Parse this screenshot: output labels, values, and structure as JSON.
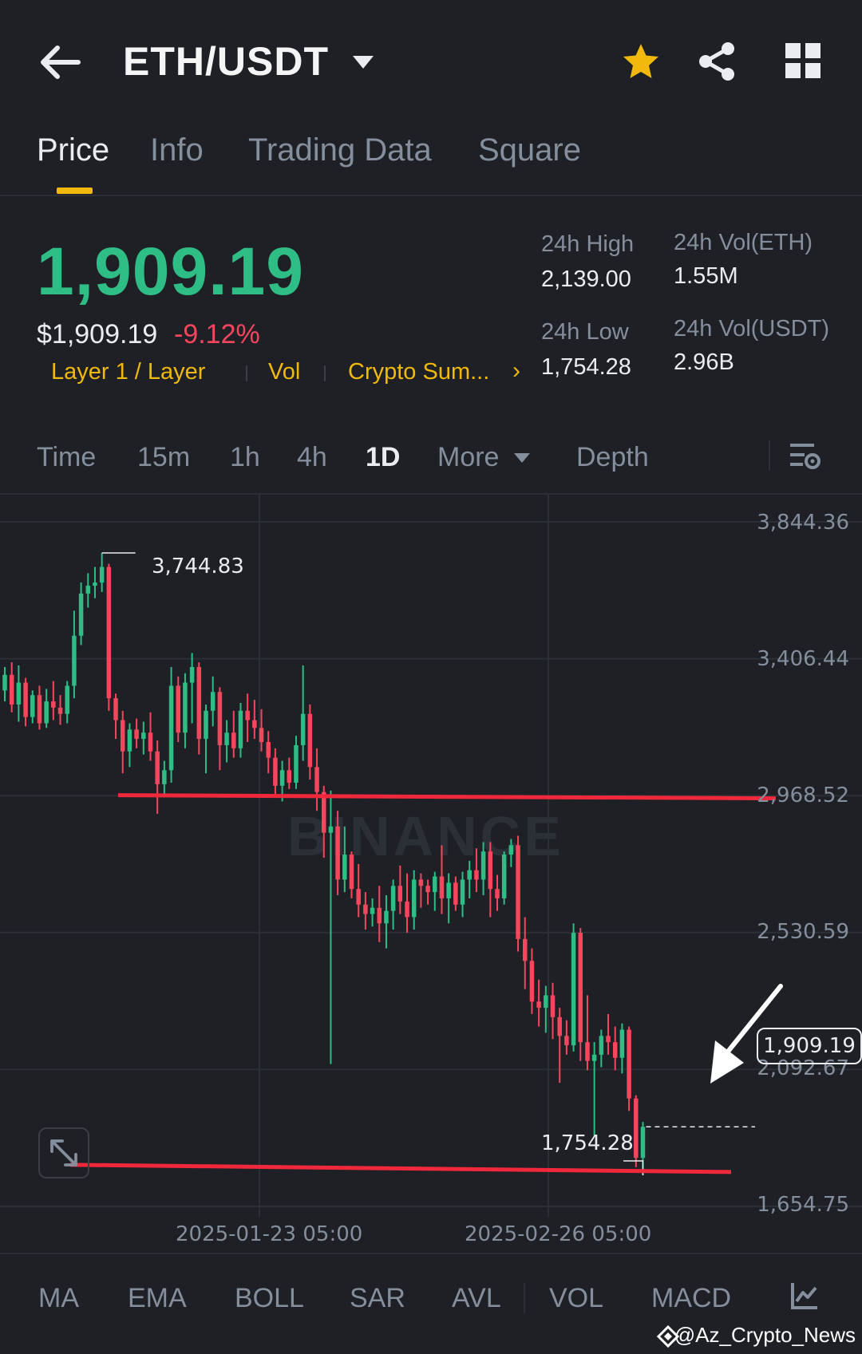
{
  "header": {
    "pair": "ETH/USDT"
  },
  "tabs": [
    {
      "label": "Price",
      "active": true
    },
    {
      "label": "Info",
      "active": false
    },
    {
      "label": "Trading Data",
      "active": false
    },
    {
      "label": "Square",
      "active": false
    }
  ],
  "price": {
    "last": "1,909.19",
    "usd": "$1,909.19",
    "change": "-9.12%",
    "tags": [
      "Layer 1 / Layer",
      "Vol",
      "Crypto Sum..."
    ],
    "tags_more": "›"
  },
  "stats": {
    "high_label": "24h High",
    "high_value": "2,139.00",
    "low_label": "24h Low",
    "low_value": "1,754.28",
    "vol_eth_label": "24h Vol(ETH)",
    "vol_eth_value": "1.55M",
    "vol_usdt_label": "24h Vol(USDT)",
    "vol_usdt_value": "2.96B"
  },
  "intervals": {
    "time": "Time",
    "m15": "15m",
    "h1": "1h",
    "h4": "4h",
    "d1": "1D",
    "more": "More",
    "depth": "Depth",
    "selected": "1D"
  },
  "chart": {
    "watermark": "BINANCE",
    "y_labels": [
      "3,844.36",
      "3,406.44",
      "2,968.52",
      "2,530.59",
      "2,092.67",
      "1,654.75"
    ],
    "x_labels": [
      "2025-01-23 05:00",
      "2025-02-26 05:00"
    ],
    "high_annotation": "3,744.83",
    "low_annotation": "1,754.28",
    "current_price_tag": "1,909.19"
  },
  "chart_data": {
    "type": "candlestick",
    "interval": "1D",
    "ylim": [
      1654.75,
      3844.36
    ],
    "y_ticks": [
      3844.36,
      3406.44,
      2968.52,
      2530.59,
      2092.67,
      1654.75
    ],
    "x_ticks": [
      "2025-01-23 05:00",
      "2025-02-26 05:00"
    ],
    "period_high": 3744.83,
    "period_low": 1754.28,
    "last_price": 1909.19,
    "drawn_lines": [
      {
        "type": "horizontal",
        "price": 2965,
        "color": "#f0283c"
      },
      {
        "type": "horizontal",
        "price": 1775,
        "color": "#f0283c"
      }
    ],
    "colors": {
      "up": "#2ebd85",
      "down": "#f6465d"
    },
    "candles": [
      [
        3305,
        3380,
        3270,
        3355
      ],
      [
        3355,
        3395,
        3235,
        3260
      ],
      [
        3260,
        3385,
        3205,
        3330
      ],
      [
        3330,
        3345,
        3190,
        3220
      ],
      [
        3220,
        3305,
        3200,
        3290
      ],
      [
        3290,
        3320,
        3180,
        3200
      ],
      [
        3200,
        3310,
        3185,
        3270
      ],
      [
        3270,
        3335,
        3210,
        3250
      ],
      [
        3250,
        3290,
        3195,
        3230
      ],
      [
        3230,
        3335,
        3200,
        3320
      ],
      [
        3320,
        3560,
        3280,
        3480
      ],
      [
        3480,
        3650,
        3450,
        3615
      ],
      [
        3615,
        3680,
        3570,
        3640
      ],
      [
        3640,
        3700,
        3600,
        3650
      ],
      [
        3650,
        3745,
        3620,
        3700
      ],
      [
        3700,
        3710,
        3240,
        3280
      ],
      [
        3280,
        3295,
        3150,
        3210
      ],
      [
        3210,
        3240,
        3040,
        3110
      ],
      [
        3110,
        3200,
        3060,
        3180
      ],
      [
        3180,
        3215,
        3120,
        3150
      ],
      [
        3150,
        3205,
        3100,
        3170
      ],
      [
        3170,
        3235,
        3080,
        3110
      ],
      [
        3110,
        3145,
        2910,
        3005
      ],
      [
        3005,
        3080,
        2970,
        3050
      ],
      [
        3050,
        3380,
        3010,
        3320
      ],
      [
        3320,
        3350,
        3140,
        3170
      ],
      [
        3170,
        3360,
        3120,
        3330
      ],
      [
        3330,
        3425,
        3200,
        3380
      ],
      [
        3380,
        3395,
        3100,
        3150
      ],
      [
        3150,
        3260,
        3040,
        3240
      ],
      [
        3240,
        3350,
        3190,
        3300
      ],
      [
        3300,
        3315,
        3050,
        3130
      ],
      [
        3130,
        3210,
        3075,
        3170
      ],
      [
        3170,
        3240,
        3090,
        3120
      ],
      [
        3120,
        3265,
        3090,
        3240
      ],
      [
        3240,
        3295,
        3140,
        3210
      ],
      [
        3210,
        3275,
        3150,
        3185
      ],
      [
        3185,
        3245,
        3110,
        3140
      ],
      [
        3140,
        3175,
        3040,
        3090
      ],
      [
        3090,
        3120,
        2965,
        3000
      ],
      [
        3000,
        3080,
        2950,
        3050
      ],
      [
        3050,
        3090,
        2990,
        3010
      ],
      [
        3010,
        3160,
        2990,
        3130
      ],
      [
        3130,
        3385,
        3080,
        3230
      ],
      [
        3230,
        3260,
        3020,
        3060
      ],
      [
        3060,
        3120,
        2920,
        2980
      ],
      [
        2980,
        3000,
        2770,
        2850
      ],
      [
        2850,
        2985,
        2110,
        2870
      ],
      [
        2870,
        2920,
        2650,
        2700
      ],
      [
        2700,
        2870,
        2660,
        2780
      ],
      [
        2780,
        2790,
        2640,
        2670
      ],
      [
        2670,
        2750,
        2580,
        2620
      ],
      [
        2620,
        2660,
        2540,
        2590
      ],
      [
        2590,
        2640,
        2550,
        2610
      ],
      [
        2610,
        2680,
        2500,
        2560
      ],
      [
        2560,
        2650,
        2480,
        2600
      ],
      [
        2600,
        2700,
        2540,
        2680
      ],
      [
        2680,
        2745,
        2590,
        2630
      ],
      [
        2630,
        2720,
        2530,
        2580
      ],
      [
        2580,
        2730,
        2540,
        2700
      ],
      [
        2700,
        2720,
        2610,
        2680
      ],
      [
        2680,
        2700,
        2620,
        2660
      ],
      [
        2660,
        2725,
        2600,
        2710
      ],
      [
        2710,
        2810,
        2590,
        2640
      ],
      [
        2640,
        2720,
        2560,
        2690
      ],
      [
        2690,
        2710,
        2600,
        2620
      ],
      [
        2620,
        2725,
        2580,
        2700
      ],
      [
        2700,
        2760,
        2640,
        2730
      ],
      [
        2730,
        2800,
        2660,
        2700
      ],
      [
        2700,
        2820,
        2650,
        2790
      ],
      [
        2790,
        2820,
        2580,
        2670
      ],
      [
        2670,
        2715,
        2600,
        2640
      ],
      [
        2640,
        2790,
        2620,
        2780
      ],
      [
        2780,
        2830,
        2740,
        2810
      ],
      [
        2810,
        2840,
        2470,
        2510
      ],
      [
        2510,
        2580,
        2350,
        2440
      ],
      [
        2440,
        2480,
        2270,
        2310
      ],
      [
        2310,
        2380,
        2230,
        2290
      ],
      [
        2290,
        2360,
        2210,
        2330
      ],
      [
        2330,
        2370,
        2190,
        2260
      ],
      [
        2260,
        2290,
        2050,
        2200
      ],
      [
        2200,
        2250,
        2140,
        2170
      ],
      [
        2170,
        2560,
        2150,
        2530
      ],
      [
        2530,
        2545,
        2120,
        2180
      ],
      [
        2180,
        2330,
        2090,
        2120
      ],
      [
        2120,
        2180,
        1880,
        2140
      ],
      [
        2140,
        2220,
        2100,
        2200
      ],
      [
        2200,
        2270,
        2140,
        2180
      ],
      [
        2180,
        2230,
        2090,
        2130
      ],
      [
        2130,
        2240,
        2080,
        2220
      ],
      [
        2220,
        2230,
        1960,
        2000
      ],
      [
        2000,
        2010,
        1780,
        1810
      ],
      [
        1810,
        1925,
        1754.28,
        1909.19
      ]
    ]
  },
  "indicators": [
    "MA",
    "EMA",
    "BOLL",
    "SAR",
    "AVL",
    "VOL",
    "MACD"
  ],
  "credit": "@Az_Crypto_News"
}
